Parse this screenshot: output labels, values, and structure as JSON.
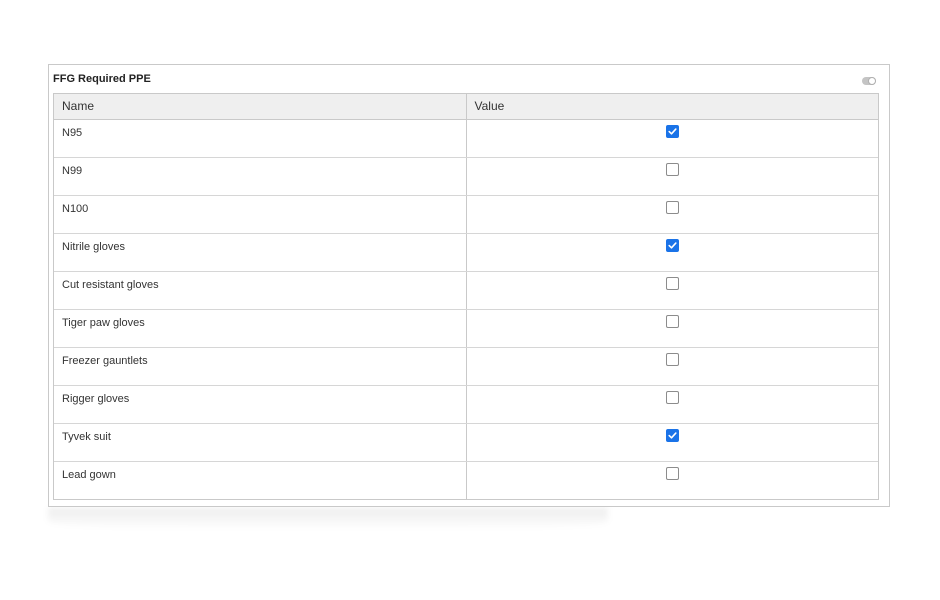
{
  "panel": {
    "title": "FFG Required PPE",
    "toggle_on": false
  },
  "table": {
    "columns": [
      "Name",
      "Value"
    ],
    "rows": [
      {
        "name": "N95",
        "checked": true
      },
      {
        "name": "N99",
        "checked": false
      },
      {
        "name": "N100",
        "checked": false
      },
      {
        "name": "Nitrile gloves",
        "checked": true
      },
      {
        "name": "Cut resistant gloves",
        "checked": false
      },
      {
        "name": "Tiger paw gloves",
        "checked": false
      },
      {
        "name": "Freezer gauntlets",
        "checked": false
      },
      {
        "name": "Rigger gloves",
        "checked": false
      },
      {
        "name": "Tyvek suit",
        "checked": true
      },
      {
        "name": "Lead gown",
        "checked": false
      }
    ]
  },
  "colors": {
    "checkbox_checked": "#1a73e8",
    "header_bg": "#efefef",
    "border": "#c9c9c9"
  },
  "icons": {
    "toggle": "toggle-switch-icon",
    "check": "checkmark-icon"
  }
}
